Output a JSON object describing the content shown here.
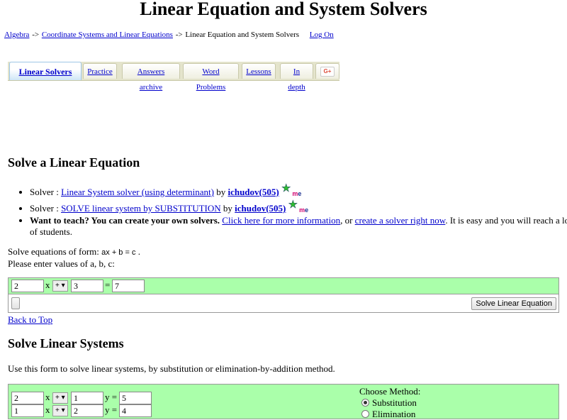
{
  "page": {
    "title": "Linear Equation and System Solvers"
  },
  "breadcrumb": {
    "items": [
      "Algebra",
      "Coordinate Systems and Linear Equations",
      "Linear Equation and System Solvers"
    ],
    "separator": "->",
    "logon": "Log On"
  },
  "tabs": {
    "items": [
      {
        "label": "Linear Solvers",
        "active": true
      },
      {
        "label": "Practice"
      },
      {
        "label": "Answers archive"
      },
      {
        "label": "Word Problems"
      },
      {
        "label": "Lessons"
      },
      {
        "label": "In depth"
      }
    ],
    "gplus": "G+"
  },
  "section1": {
    "heading": "Solve a Linear Equation",
    "solvers": [
      {
        "prefix": "Solver : ",
        "link": "Linear System solver (using determinant)",
        "by": " by ",
        "author": "ichudov(505)"
      },
      {
        "prefix": "Solver : ",
        "link": "SOLVE linear system by SUBSTITUTION",
        "by": " by ",
        "author": "ichudov(505)"
      }
    ],
    "star_glyph": "★",
    "me_m": "m",
    "me_e": "e",
    "teach": {
      "bold": "Want to teach? You can create your own solvers.",
      "link1": "Click here for more information",
      "mid": ", or ",
      "link2": "create a solver right now",
      "tail": ". It is easy and you will reach a lot of students."
    },
    "form_prefix": "Solve equations of form: ",
    "formula": "ax + b = c",
    "form_suffix": " .",
    "form_line2": "Please enter values of a, b, c:",
    "inputs": {
      "a": "2",
      "x": "x",
      "op": "+",
      "b": "3",
      "eq": "=",
      "c": "7"
    },
    "select_arrow": "▾",
    "solve_button": "Solve Linear Equation",
    "back_to_top": "Back to Top"
  },
  "section2": {
    "heading": "Solve Linear Systems",
    "description": "Use this form to solve linear systems, by substitution or elimination-by-addition method.",
    "row1": {
      "a": "2",
      "x": "x",
      "op": "+",
      "b": "1",
      "y": "y =",
      "c": "5"
    },
    "row2": {
      "a": "1",
      "x": "x",
      "op": "+",
      "b": "2",
      "y": "y =",
      "c": "4"
    },
    "method_label": "Choose Method:",
    "methods": [
      "Substitution",
      "Elimination"
    ]
  }
}
